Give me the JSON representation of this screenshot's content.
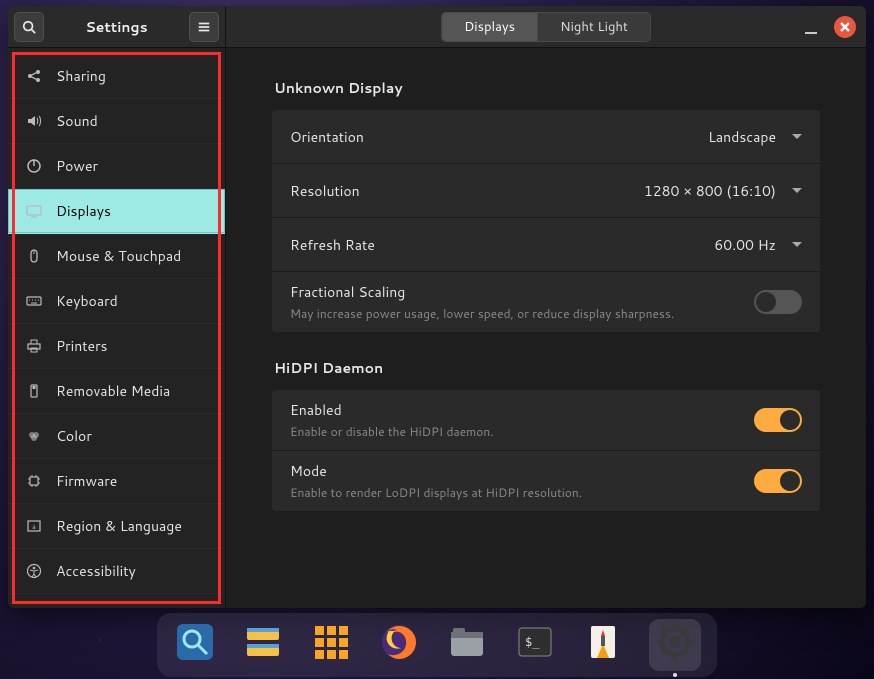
{
  "header": {
    "title": "Settings",
    "tabs": [
      {
        "label": "Displays",
        "active": true
      },
      {
        "label": "Night Light",
        "active": false
      }
    ]
  },
  "sidebar": {
    "items": [
      {
        "icon": "share",
        "label": "Sharing",
        "selected": false
      },
      {
        "icon": "sound",
        "label": "Sound",
        "selected": false
      },
      {
        "icon": "power",
        "label": "Power",
        "selected": false
      },
      {
        "icon": "display",
        "label": "Displays",
        "selected": true
      },
      {
        "icon": "mouse",
        "label": "Mouse & Touchpad",
        "selected": false
      },
      {
        "icon": "keyboard",
        "label": "Keyboard",
        "selected": false
      },
      {
        "icon": "printer",
        "label": "Printers",
        "selected": false
      },
      {
        "icon": "removable",
        "label": "Removable Media",
        "selected": false
      },
      {
        "icon": "color",
        "label": "Color",
        "selected": false
      },
      {
        "icon": "firmware",
        "label": "Firmware",
        "selected": false
      },
      {
        "icon": "region",
        "label": "Region & Language",
        "selected": false
      },
      {
        "icon": "accessibility",
        "label": "Accessibility",
        "selected": false
      }
    ]
  },
  "panel": {
    "section1_title": "Unknown Display",
    "orientation": {
      "label": "Orientation",
      "value": "Landscape"
    },
    "resolution": {
      "label": "Resolution",
      "value": "1280 × 800 (16:10)"
    },
    "refresh": {
      "label": "Refresh Rate",
      "value": "60.00 Hz"
    },
    "fractional": {
      "label": "Fractional Scaling",
      "sub": "May increase power usage, lower speed, or reduce display sharpness.",
      "on": false
    },
    "section2_title": "HiDPI Daemon",
    "enabled": {
      "label": "Enabled",
      "sub": "Enable or disable the HiDPI daemon.",
      "on": true
    },
    "mode": {
      "label": "Mode",
      "sub": "Enable to render LoDPI displays at HiDPI resolution.",
      "on": true
    }
  },
  "dock": {
    "apps": [
      {
        "name": "search",
        "active": false
      },
      {
        "name": "files-alt",
        "active": false
      },
      {
        "name": "apps-grid",
        "active": false
      },
      {
        "name": "firefox",
        "active": false
      },
      {
        "name": "files",
        "active": false
      },
      {
        "name": "terminal",
        "active": false
      },
      {
        "name": "text-editor",
        "active": false
      },
      {
        "name": "settings",
        "active": true
      }
    ]
  },
  "colors": {
    "accent_teal": "#9de9e3",
    "accent_orange": "#ffab40",
    "close_red": "#e9573f",
    "highlight_red": "#ff2b2b"
  }
}
